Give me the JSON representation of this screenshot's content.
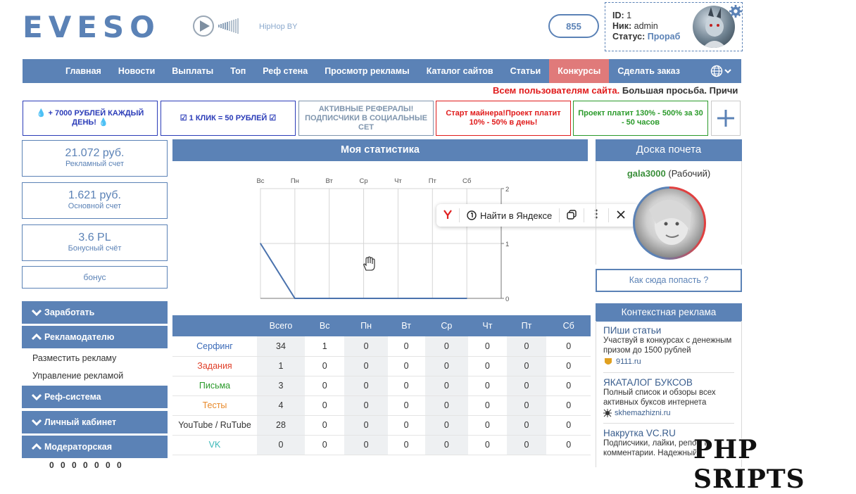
{
  "header": {
    "logo": "EVESO",
    "radio_name": "HipHop BY",
    "counter": "855",
    "user": {
      "id_label": "ID:",
      "id_value": "1",
      "nick_label": "Ник:",
      "nick_value": "admin",
      "status_label": "Статус:",
      "status_value": "Прораб"
    }
  },
  "nav": {
    "items": [
      "Главная",
      "Новости",
      "Выплаты",
      "Топ",
      "Реф стена",
      "Просмотр рекламы",
      "Каталог сайтов",
      "Статьи",
      "Конкурсы",
      "Сделать заказ"
    ],
    "active_index": 8
  },
  "ticker": {
    "red": "Всем пользователям сайта.",
    "black": " Большая просьба. Причи"
  },
  "promos": [
    {
      "text": "💧 + 7000 РУБЛЕЙ КАЖДЫЙ ДЕНЬ! 💧",
      "color": "#2b3cb8"
    },
    {
      "text": "☑ 1 КЛИК = 50 РУБЛЕЙ ☑",
      "color": "#2b3cb8"
    },
    {
      "text": "АКТИВНЫЕ РЕФЕРАЛЫ! ПОДПИСЧИКИ В СОЦИАЛЬНЫЕ СЕТ",
      "color": "#7f95ad"
    },
    {
      "text": "Старт майнера!Проект платит 10% - 50% в день!",
      "color": "#e01b1b"
    },
    {
      "text": "Проект платит 130% - 500% за 30 - 50 часов",
      "color": "#2a9a2a"
    }
  ],
  "accounts": [
    {
      "amount": "21.072 руб.",
      "label": "Рекламный счет"
    },
    {
      "amount": "1.621 руб.",
      "label": "Основной счет"
    },
    {
      "amount": "3.6 PL",
      "label": "Бонусный счёт"
    }
  ],
  "bonus_label": "бонус",
  "sidebar": {
    "earn": "Заработать",
    "advertiser": "Рекламодателю",
    "advertiser_links": [
      "Разместить рекламу",
      "Управление рекламой"
    ],
    "referral": "Реф-система",
    "cabinet": "Личный кабинет",
    "moderator": "Модераторская"
  },
  "stats": {
    "title": "Моя статистика",
    "columns": [
      "",
      "Всего",
      "Вс",
      "Пн",
      "Вт",
      "Ср",
      "Чт",
      "Пт",
      "Сб"
    ],
    "rows": [
      {
        "name": "Серфинг",
        "color": "#3a6ab8",
        "values": [
          "34",
          "1",
          "0",
          "0",
          "0",
          "0",
          "0",
          "0"
        ]
      },
      {
        "name": "Задания",
        "color": "#e0402a",
        "values": [
          "1",
          "0",
          "0",
          "0",
          "0",
          "0",
          "0",
          "0"
        ]
      },
      {
        "name": "Письма",
        "color": "#2a9a2a",
        "values": [
          "3",
          "0",
          "0",
          "0",
          "0",
          "0",
          "0",
          "0"
        ]
      },
      {
        "name": "Тесты",
        "color": "#e8892a",
        "values": [
          "4",
          "0",
          "0",
          "0",
          "0",
          "0",
          "0",
          "0"
        ]
      },
      {
        "name": "YouTube / RuTube",
        "color": "#333333",
        "values": [
          "28",
          "0",
          "0",
          "0",
          "0",
          "0",
          "0",
          "0"
        ]
      },
      {
        "name": "VK",
        "color": "#3ab8b8",
        "values": [
          "0",
          "0",
          "0",
          "0",
          "0",
          "0",
          "0",
          "0"
        ]
      }
    ]
  },
  "chart_data": {
    "type": "line",
    "categories": [
      "Вс",
      "Пн",
      "Вт",
      "Ср",
      "Чт",
      "Пт",
      "Сб"
    ],
    "yticks": [
      "2",
      "1",
      "0"
    ],
    "ylim": [
      0,
      2
    ],
    "series": [
      {
        "values": [
          1,
          0,
          0,
          0,
          0,
          0,
          0
        ]
      }
    ]
  },
  "yandex_popup": {
    "search_label": "Найти в Яндексе"
  },
  "honor_board": {
    "title": "Доска почета",
    "user": "gala3000",
    "role": " (Рабочий)",
    "how_to": "Как сюда попасть ?"
  },
  "context_ads": {
    "title": "Контекстная реклама",
    "ads": [
      {
        "title": "ПИши статьи",
        "desc": "Участвуй в конкурсах с денежным призом до 1500 рублей",
        "site": "9111.ru"
      },
      {
        "title": "ЯКАТАЛОГ БУКСОВ",
        "desc": "Полный список и обзоры всех активных буксов интернета",
        "site": "skhemazhizni.ru"
      },
      {
        "title": "Накрутка VC.RU",
        "desc": "Подписчики, лайки, репосты, комментарии. Надежный",
        "site": ""
      }
    ]
  },
  "bottom_counter": "0 0 0 0 0 0 0",
  "watermark": "PHP SRIPTS"
}
